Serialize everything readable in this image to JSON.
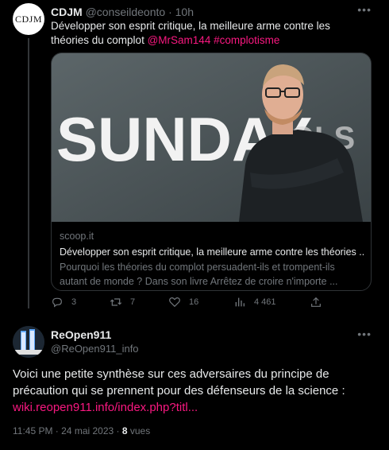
{
  "tweet1": {
    "avatar_text": "CDJM",
    "name": "CDJM",
    "handle": "@conseildeonto",
    "separator": "·",
    "time": "10h",
    "text": "Développer son esprit critique, la meilleure arme contre les théories du complot",
    "mention": "@MrSam144",
    "hashtag": "#complotisme",
    "card": {
      "image_text": "SUNDAY",
      "domain": "scoop.it",
      "title": "Développer son esprit critique, la meilleure arme contre les théories ...",
      "description": "Pourquoi les théories du complot persuadent-ils et trompent-ils autant de monde ? Dans son livre Arrêtez de croire n'importe ..."
    },
    "actions": {
      "replies": "3",
      "retweets": "7",
      "likes": "16",
      "views": "4 461"
    }
  },
  "tweet2": {
    "name": "ReOpen911",
    "handle": "@ReOpen911_info",
    "text": "Voici une petite synthèse sur ces adversaires du principe de précaution qui se prennent pour des défenseurs de la science :",
    "link": "wiki.reopen911.info/index.php?titl...",
    "time": "11:45 PM · 24 mai 2023 · ",
    "views_count": "8",
    "views_label": " vues"
  },
  "colors": {
    "accent": "#f91880",
    "muted": "#71767b",
    "text": "#e7e9ea",
    "border": "#2f3336"
  },
  "icons": [
    "more-icon",
    "reply-icon",
    "retweet-icon",
    "like-icon",
    "views-icon",
    "share-icon"
  ]
}
